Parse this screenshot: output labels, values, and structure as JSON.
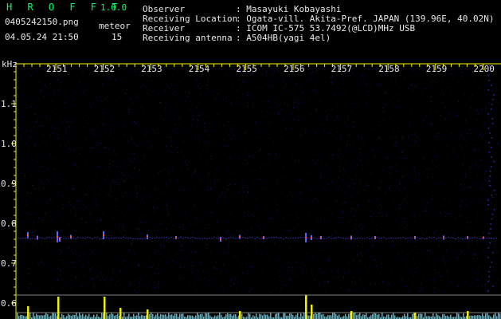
{
  "app": {
    "title": "H R O F F T",
    "version": "1.0.0"
  },
  "file": {
    "name": "0405242150.png",
    "datetime": "04.05.24 21:50"
  },
  "meteor": {
    "label": "meteor",
    "count": "15"
  },
  "info": [
    {
      "key": "Observer",
      "value": ": Masayuki Kobayashi"
    },
    {
      "key": "Receiving Location",
      "value": ": Ogata-vill. Akita-Pref. JAPAN (139.96E, 40.02N)"
    },
    {
      "key": "Receiver",
      "value": ": ICOM IC-575 53.7492(@LCD)MHz USB"
    },
    {
      "key": "Receiving antenna",
      "value": ": A504HB(yagi 4el)"
    }
  ],
  "spectrogram": {
    "y_unit": "kHz",
    "y_ticks": [
      "1.1",
      "1.0",
      "0.9",
      "0.8",
      "0.7",
      "0.6"
    ],
    "x_ticks": [
      "2151",
      "2152",
      "2153",
      "2154",
      "2155",
      "2156",
      "2157",
      "2158",
      "2159",
      "2200"
    ],
    "colors": {
      "axis": "#f2f200",
      "grid": "#7f7f7f",
      "noise": "#1a1a90",
      "signal": "#ff5050",
      "level_bar": "#f0f000",
      "level_cyan": "#5fe6ff"
    }
  }
}
